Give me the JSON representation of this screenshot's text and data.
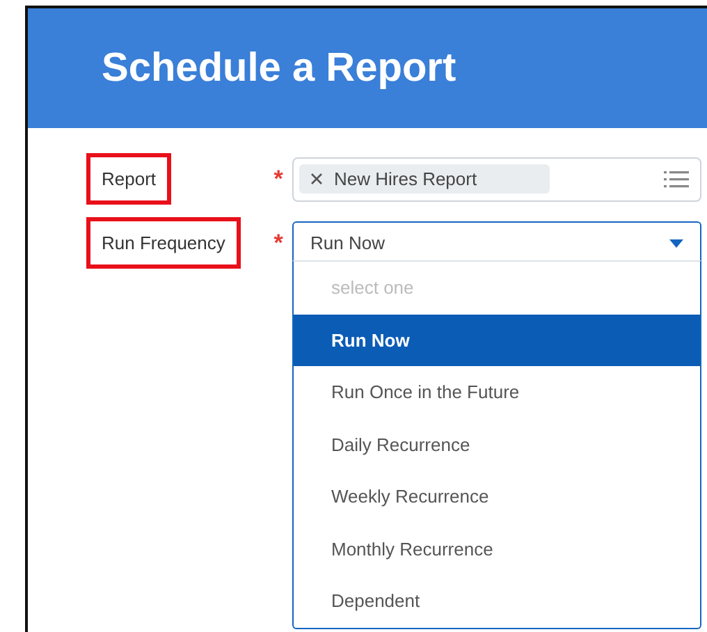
{
  "header": {
    "title": "Schedule a Report"
  },
  "fields": [
    {
      "label": "Report",
      "highlighted": true,
      "required_mark": "*",
      "kind": "tokens",
      "tokens": [
        {
          "text": "New Hires Report"
        }
      ]
    },
    {
      "label": "Run Frequency",
      "highlighted": true,
      "required_mark": "*",
      "kind": "select",
      "value": "Run Now",
      "expanded": true,
      "options": [
        {
          "label": "select one",
          "kind": "placeholder",
          "selected": false
        },
        {
          "label": "Run Now",
          "kind": "option",
          "selected": true
        },
        {
          "label": "Run Once in the Future",
          "kind": "option",
          "selected": false
        },
        {
          "label": "Daily Recurrence",
          "kind": "option",
          "selected": false
        },
        {
          "label": "Weekly Recurrence",
          "kind": "option",
          "selected": false
        },
        {
          "label": "Monthly Recurrence",
          "kind": "option",
          "selected": false
        },
        {
          "label": "Dependent",
          "kind": "option",
          "selected": false
        }
      ]
    }
  ]
}
